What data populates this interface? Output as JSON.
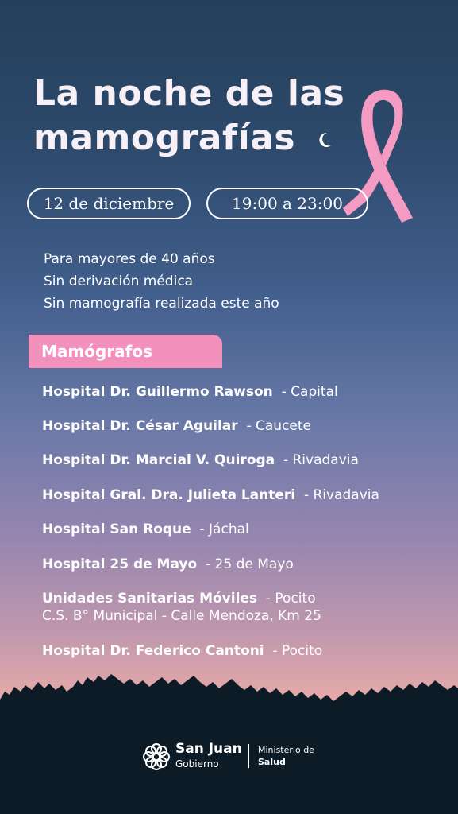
{
  "title": {
    "line1": "La noche de las",
    "line2": "mamografías"
  },
  "event": {
    "date": "12 de diciembre",
    "time": "19:00 a 23:00"
  },
  "requirements": [
    "Para mayores de 40 años",
    "Sin derivación médica",
    "Sin mamografía realizada este año"
  ],
  "section_label": "Mamógrafos",
  "hospitals": [
    {
      "name": "Hospital Dr. Guillermo Rawson",
      "location": "- Capital",
      "extra": ""
    },
    {
      "name": "Hospital Dr. César Aguilar",
      "location": "- Caucete",
      "extra": ""
    },
    {
      "name": "Hospital Dr. Marcial V. Quiroga",
      "location": "- Rivadavia",
      "extra": ""
    },
    {
      "name": "Hospital Gral. Dra. Julieta Lanteri",
      "location": "- Rivadavia",
      "extra": ""
    },
    {
      "name": "Hospital San Roque",
      "location": "- Jáchal",
      "extra": ""
    },
    {
      "name": "Hospital 25 de Mayo",
      "location": "- 25 de Mayo",
      "extra": ""
    },
    {
      "name": "Unidades Sanitarias Móviles",
      "location": "- Pocito",
      "extra": "C.S. B° Municipal - Calle Mendoza, Km 25"
    },
    {
      "name": "Hospital Dr. Federico Cantoni",
      "location": "- Pocito",
      "extra": ""
    }
  ],
  "footer": {
    "brand": "San Juan",
    "brand_sub": "Gobierno",
    "ministry_line1": "Ministerio de",
    "ministry_line2": "Salud"
  },
  "colors": {
    "accent_pink": "#f291bb",
    "ribbon_pink": "#f49bc4",
    "sky_top": "#243f5b",
    "sky_bottom": "#f3b4a6",
    "silhouette": "#0c1b26"
  },
  "icons": [
    "moon-icon",
    "pink-ribbon-icon",
    "san-juan-logo-icon"
  ]
}
